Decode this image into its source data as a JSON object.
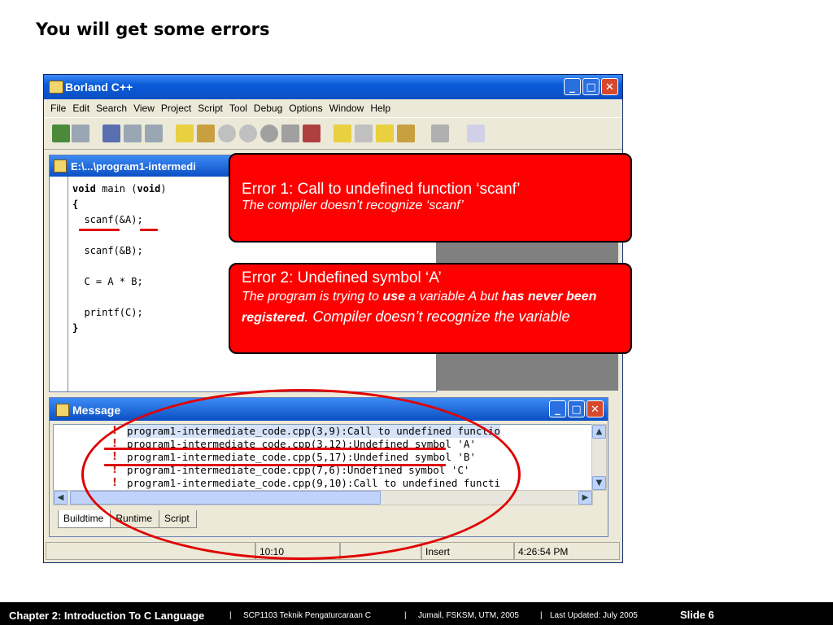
{
  "slide": {
    "title": "You will get some errors"
  },
  "window": {
    "title": "Borland C++",
    "menu": [
      "File",
      "Edit",
      "Search",
      "View",
      "Project",
      "Script",
      "Tool",
      "Debug",
      "Options",
      "Window",
      "Help"
    ],
    "controls": {
      "minimize": "_",
      "maximize": "□",
      "close": "✕"
    }
  },
  "editor": {
    "title": "E:\\...\\program1-intermedi",
    "code": {
      "l1_kw": "void",
      "l1_mid": " main (",
      "l1_kw2": "void",
      "l1_end": ")",
      "l2": "{",
      "l3": "  scanf(&A);",
      "l4": "  scanf(&B);",
      "l5": "  C = A * B;",
      "l6": "  printf(C);",
      "l7": "}"
    }
  },
  "message": {
    "title": "Message",
    "rows": [
      "program1-intermediate_code.cpp(3,9):Call to undefined functio",
      "program1-intermediate_code.cpp(3,12):Undefined symbol 'A'",
      "program1-intermediate_code.cpp(5,17):Undefined symbol 'B'",
      "program1-intermediate_code.cpp(7,6):Undefined symbol 'C'",
      "program1-intermediate_code.cpp(9,10):Call to undefined functi"
    ],
    "tabs": [
      "Buildtime",
      "Runtime",
      "Script"
    ]
  },
  "status": {
    "position": "10:10",
    "mode": "Insert",
    "time": "4:26:54 PM"
  },
  "callout1": {
    "heading": "Error 1: Call to undefined function ‘scanf’",
    "sub": "The compiler doesn’t  recognize ‘scanf’"
  },
  "callout2": {
    "heading": "Error 2: Undefined symbol ‘A’",
    "p1": "The program is trying to ",
    "p2": "use",
    "p3": " a variable A but ",
    "p4": "has never been registered",
    "p5": ". Compiler doesn’t recognize the variable"
  },
  "footer": {
    "chapter": "Chapter 2: Introduction To C Language",
    "sep": "|",
    "course": "SCP1103   Teknik Pengaturcaraan C",
    "author": "Jumail, FSKSM, UTM, 2005",
    "updated": "Last Updated: July 2005",
    "slide": "Slide 6"
  }
}
